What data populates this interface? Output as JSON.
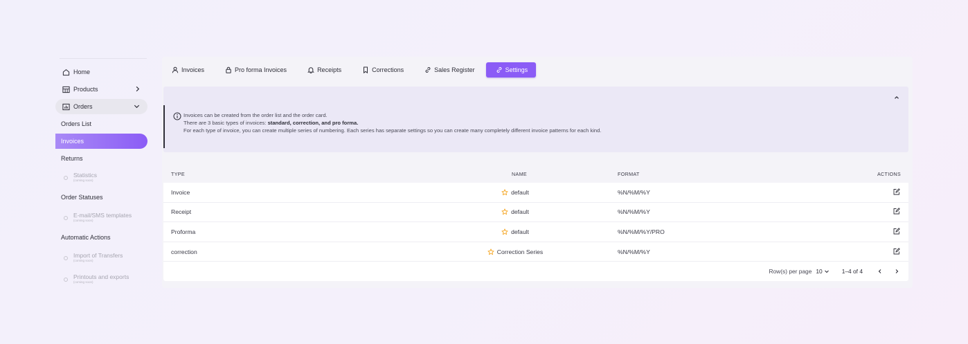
{
  "sidebar": {
    "home": "Home",
    "products": "Products",
    "orders": "Orders",
    "orders_list": "Orders List",
    "invoices": "Invoices",
    "returns": "Returns",
    "statistics": "Statistics",
    "statistics_note": "(coming soon)",
    "order_statuses": "Order Statuses",
    "email_sms": "E-mail/SMS templates",
    "email_sms_note": "(coming soon)",
    "automatic_actions": "Automatic Actions",
    "import_transfers": "Import of Transfers",
    "import_transfers_note": "(coming soon)",
    "printouts": "Printouts and exports",
    "printouts_note": "(coming soon)"
  },
  "tabs": [
    {
      "label": "Invoices",
      "icon": "user-icon"
    },
    {
      "label": "Pro forma Invoices",
      "icon": "lock-icon"
    },
    {
      "label": "Receipts",
      "icon": "bell-icon"
    },
    {
      "label": "Corrections",
      "icon": "bookmark-icon"
    },
    {
      "label": "Sales Register",
      "icon": "link-icon"
    },
    {
      "label": "Settings",
      "icon": "link-icon",
      "active": true
    }
  ],
  "info": {
    "line1": "Invoices can be created from the order list and the order card.",
    "line2_prefix": "There are 3 basic types of invoices: ",
    "line2_bold": "standard, correction, and pro forma.",
    "line3": "For each type of invoice, you can create multiple series of numbering. Each series has separate settings so you can create many completely different invoice patterns for each kind."
  },
  "table": {
    "headers": {
      "type": "TYPE",
      "name": "NAME",
      "format": "FORMAT",
      "actions": "ACTIONS"
    },
    "rows": [
      {
        "type": "Invoice",
        "name": "default",
        "format": "%N/%M/%Y"
      },
      {
        "type": "Receipt",
        "name": "default",
        "format": "%N/%M/%Y"
      },
      {
        "type": "Proforma",
        "name": "default",
        "format": "%N/%M/%Y/PRO"
      },
      {
        "type": "correction",
        "name": "Correction Series",
        "format": "%N/%M/%Y"
      }
    ]
  },
  "pagination": {
    "rows_per_page_label": "Row(s) per page",
    "rows_per_page_value": "10",
    "range": "1–4 of 4"
  },
  "colors": {
    "accent": "#8b5cf6",
    "star": "#f5a623"
  }
}
